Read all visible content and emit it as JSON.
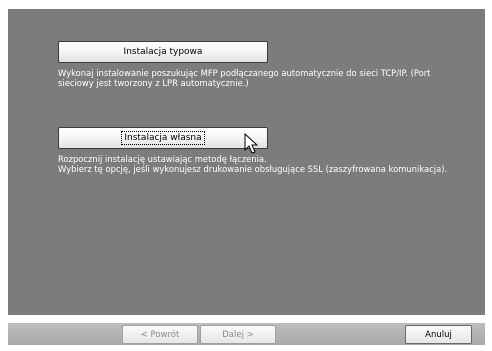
{
  "options": [
    {
      "button_label": "Instalacja typowa",
      "description_line1": "Wykonaj instalowanie poszukując MFP podłączanego automatycznie do sieci  TCP/IP.  (Port",
      "description_line2": "sieciowy jest tworzony z  LPR automatycznie.)"
    },
    {
      "button_label": "Instalacja własna",
      "description_line1": "Rozpocznij  instalację ustawiając metodę łączenia.",
      "description_line2": "Wybierz tę opcję, jeśli wykonujesz drukowanie obsługujące SSL (zaszyfrowana komunikacja)."
    }
  ],
  "nav": {
    "back_label": "< Powrót",
    "next_label": "Dalej >",
    "cancel_label": "Anuluj"
  }
}
